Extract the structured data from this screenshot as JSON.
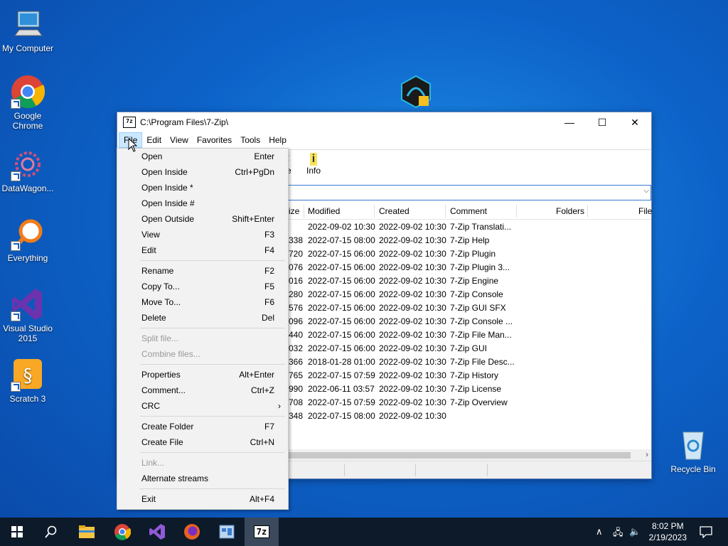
{
  "desktop": {
    "icons": [
      {
        "label": "My Computer"
      },
      {
        "label": "Google Chrome"
      },
      {
        "label": "DataWagon..."
      },
      {
        "label": "Everything"
      },
      {
        "label": "Visual Studio 2015"
      },
      {
        "label": "Scratch 3"
      },
      {
        "label": "Recycle Bin"
      }
    ]
  },
  "window": {
    "title": "C:\\Program Files\\7-Zip\\",
    "app_icon_text": "7z",
    "controls": {
      "minimize": "—",
      "maximize": "☐",
      "close": "✕"
    }
  },
  "menubar": [
    "File",
    "Edit",
    "View",
    "Favorites",
    "Tools",
    "Help"
  ],
  "toolbar": {
    "delete_partial": "ete",
    "info": "Info"
  },
  "columns": {
    "size": "ize",
    "modified": "Modified",
    "created": "Created",
    "comment": "Comment",
    "folders": "Folders",
    "files": "File"
  },
  "rows": [
    {
      "size": "",
      "modified": "2022-09-02 10:30",
      "created": "2022-09-02 10:30",
      "comment": "7-Zip Translati..."
    },
    {
      "size": "338",
      "modified": "2022-07-15 08:00",
      "created": "2022-09-02 10:30",
      "comment": "7-Zip Help"
    },
    {
      "size": "720",
      "modified": "2022-07-15 06:00",
      "created": "2022-09-02 10:30",
      "comment": "7-Zip Plugin"
    },
    {
      "size": "076",
      "modified": "2022-07-15 06:00",
      "created": "2022-09-02 10:30",
      "comment": "7-Zip Plugin 3..."
    },
    {
      "size": "016",
      "modified": "2022-07-15 06:00",
      "created": "2022-09-02 10:30",
      "comment": "7-Zip Engine"
    },
    {
      "size": "280",
      "modified": "2022-07-15 06:00",
      "created": "2022-09-02 10:30",
      "comment": "7-Zip Console"
    },
    {
      "size": "576",
      "modified": "2022-07-15 06:00",
      "created": "2022-09-02 10:30",
      "comment": "7-Zip GUI SFX"
    },
    {
      "size": "096",
      "modified": "2022-07-15 06:00",
      "created": "2022-09-02 10:30",
      "comment": "7-Zip Console ..."
    },
    {
      "size": "440",
      "modified": "2022-07-15 06:00",
      "created": "2022-09-02 10:30",
      "comment": "7-Zip File Man..."
    },
    {
      "size": "032",
      "modified": "2022-07-15 06:00",
      "created": "2022-09-02 10:30",
      "comment": "7-Zip GUI"
    },
    {
      "size": "366",
      "modified": "2018-01-28 01:00",
      "created": "2022-09-02 10:30",
      "comment": "7-Zip File Desc..."
    },
    {
      "size": "765",
      "modified": "2022-07-15 07:59",
      "created": "2022-09-02 10:30",
      "comment": "7-Zip History"
    },
    {
      "size": "990",
      "modified": "2022-06-11 03:57",
      "created": "2022-09-02 10:30",
      "comment": "7-Zip License"
    },
    {
      "size": "708",
      "modified": "2022-07-15 07:59",
      "created": "2022-09-02 10:30",
      "comment": "7-Zip Overview"
    },
    {
      "size": "348",
      "modified": "2022-07-15 08:00",
      "created": "2022-09-02 10:30",
      "comment": ""
    }
  ],
  "file_menu": [
    {
      "label": "Open",
      "key": "Enter"
    },
    {
      "label": "Open Inside",
      "key": "Ctrl+PgDn"
    },
    {
      "label": "Open Inside *",
      "key": ""
    },
    {
      "label": "Open Inside #",
      "key": ""
    },
    {
      "label": "Open Outside",
      "key": "Shift+Enter"
    },
    {
      "label": "View",
      "key": "F3"
    },
    {
      "label": "Edit",
      "key": "F4"
    },
    {
      "label": "Rename",
      "key": "F2"
    },
    {
      "label": "Copy To...",
      "key": "F5"
    },
    {
      "label": "Move To...",
      "key": "F6"
    },
    {
      "label": "Delete",
      "key": "Del"
    },
    {
      "label": "Split file...",
      "key": ""
    },
    {
      "label": "Combine files...",
      "key": ""
    },
    {
      "label": "Properties",
      "key": "Alt+Enter"
    },
    {
      "label": "Comment...",
      "key": "Ctrl+Z"
    },
    {
      "label": "CRC",
      "key": "›"
    },
    {
      "label": "Create Folder",
      "key": "F7"
    },
    {
      "label": "Create File",
      "key": "Ctrl+N"
    },
    {
      "label": "Link...",
      "key": ""
    },
    {
      "label": "Alternate streams",
      "key": ""
    },
    {
      "label": "Exit",
      "key": "Alt+F4"
    }
  ],
  "taskbar": {
    "time": "8:02 PM",
    "date": "2/19/2023",
    "app_7z": "7z"
  },
  "colors": {
    "desktop": "#0d63c9",
    "menu_hover": "#cce8ff",
    "taskbar": "#0d1a2a"
  }
}
